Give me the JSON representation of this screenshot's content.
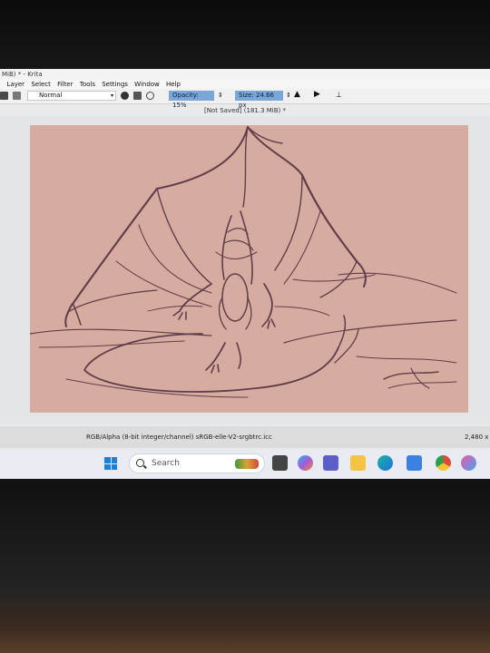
{
  "window": {
    "title": "MiB) * - Krita"
  },
  "menu": {
    "items": [
      "e",
      "Layer",
      "Select",
      "Filter",
      "Tools",
      "Settings",
      "Window",
      "Help"
    ]
  },
  "toolbar": {
    "blend_mode": "Normal",
    "opacity_label": "Opacity: 15%",
    "size_label": "Size: 24.66 px"
  },
  "document": {
    "status": "[Not Saved]  (181.3 MiB) *"
  },
  "statusbar": {
    "color_info": "RGB/Alpha (8-bit integer/channel)  sRGB-elle-V2-srgbtrc.icc",
    "dimensions": "2,480 x"
  },
  "taskbar": {
    "search_placeholder": "Search",
    "apps": [
      "windows-start-icon",
      "task-view-icon",
      "copilot-icon",
      "teams-icon",
      "file-explorer-icon",
      "edge-icon",
      "store-icon",
      "chrome-icon",
      "krita-icon"
    ]
  },
  "colors": {
    "canvas_bg": "#d7aca0",
    "sketch_stroke": "#4d2a3b",
    "highlight": "#7aa7d8"
  }
}
